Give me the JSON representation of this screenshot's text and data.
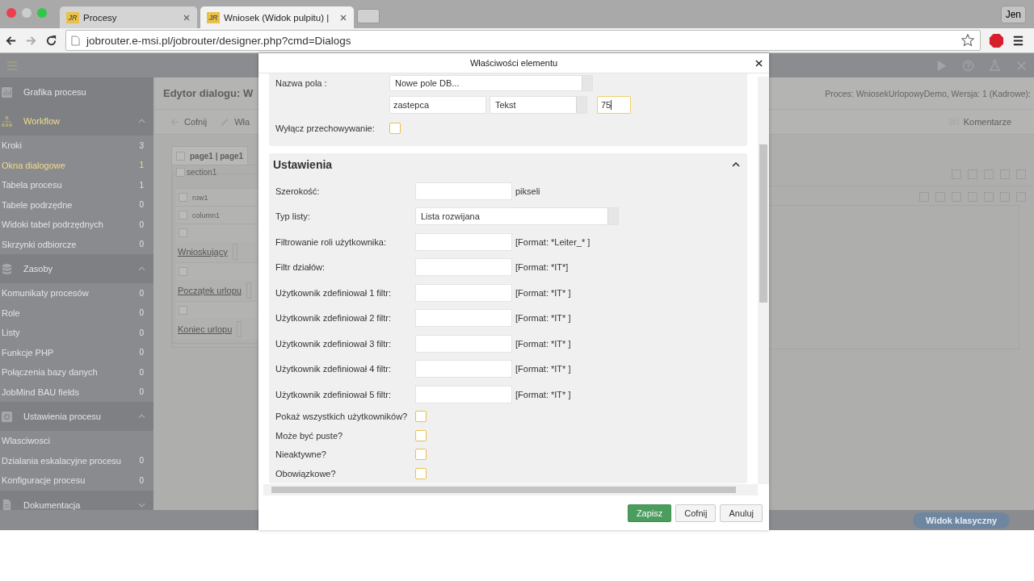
{
  "browser": {
    "tabs": [
      {
        "favicon_text": "JR",
        "title": "Procesy",
        "selected": false
      },
      {
        "favicon_text": "JR",
        "title": "Wniosek (Widok pulpitu) |",
        "selected": true
      }
    ],
    "url": "jobrouter.e-msi.pl/jobrouter/designer.php?cmd=Dialogs",
    "profile": "Jen"
  },
  "sidebar": [
    {
      "kind": "link",
      "label": "Grafika procesu"
    },
    {
      "kind": "group",
      "label": "Workflow",
      "expanded": true,
      "active": true,
      "items": [
        {
          "label": "Kroki",
          "count": "3",
          "selected": false
        },
        {
          "label": "Okna dialogowe",
          "count": "1",
          "selected": true
        },
        {
          "label": "Tabela procesu",
          "count": "1",
          "selected": false
        },
        {
          "label": "Tabele podrzędne",
          "count": "0",
          "selected": false
        },
        {
          "label": "Widoki tabel podrzędnych",
          "count": "0",
          "selected": false
        },
        {
          "label": "Skrzynki odbiorcze",
          "count": "0",
          "selected": false
        }
      ]
    },
    {
      "kind": "group",
      "label": "Zasoby",
      "expanded": true,
      "active": false,
      "items": [
        {
          "label": "Komunikaty procesów",
          "count": "0",
          "selected": false
        },
        {
          "label": "Role",
          "count": "0",
          "selected": false
        },
        {
          "label": "Listy",
          "count": "0",
          "selected": false
        },
        {
          "label": "Funkcje PHP",
          "count": "0",
          "selected": false
        },
        {
          "label": "Połączenia bazy danych",
          "count": "0",
          "selected": false
        },
        {
          "label": "JobMind BAU fields",
          "count": "0",
          "selected": false
        }
      ]
    },
    {
      "kind": "group",
      "label": "Ustawienia procesu",
      "expanded": true,
      "active": false,
      "items": [
        {
          "label": "Wlasciwosci",
          "selected": false
        },
        {
          "label": "Dzialania eskalacyjne procesu",
          "count": "0",
          "selected": false
        },
        {
          "label": "Konfiguracje procesu",
          "count": "0",
          "selected": false
        }
      ]
    },
    {
      "kind": "group",
      "label": "Dokumentacja",
      "expanded": false,
      "active": false
    }
  ],
  "editor": {
    "title": "Edytor dialogu: W",
    "process": "Proces: WniosekUrlopowyDemo, Wersja: 1 (Kadrowe):",
    "toolbar": [
      "Cofnij",
      "Wła"
    ],
    "comments": "Komentarze",
    "page_tab": "page1 | page1",
    "section": "section1",
    "rows": [
      "row1",
      "column1"
    ],
    "fields": [
      "Wnioskujący",
      "Początek urlopu",
      "Koniec urlopu"
    ],
    "footer_button": "Widok klasyczny"
  },
  "dialog": {
    "title": "Właściwości elementu",
    "field": {
      "label": "Nazwa pola :",
      "db_field": "Nowe pole DB...",
      "name": "zastepca",
      "type": "Tekst",
      "length": "75",
      "disable_storage_label": "Wyłącz przechowywanie:",
      "disable_storage": false
    },
    "settings": {
      "title": "Ustawienia",
      "expanded": true,
      "rows": [
        {
          "kind": "input",
          "label": "Szerokość:",
          "suffix": "pikseli"
        },
        {
          "kind": "select",
          "label": "Typ listy:",
          "value": "Lista rozwijana"
        },
        {
          "kind": "input",
          "label": "Filtrowanie roli użytkownika:",
          "suffix": "[Format: *Leiter_* ]"
        },
        {
          "kind": "input",
          "label": "Filtr działów:",
          "suffix": "[Format: *IT*]"
        },
        {
          "kind": "input",
          "label": "Użytkownik zdefiniował 1 filtr:",
          "suffix": "[Format: *IT* ]"
        },
        {
          "kind": "input",
          "label": "Użytkownik zdefiniował 2 filtr:",
          "suffix": "[Format: *IT* ]"
        },
        {
          "kind": "input",
          "label": "Użytkownik zdefiniował 3 filtr:",
          "suffix": "[Format: *IT* ]"
        },
        {
          "kind": "input",
          "label": "Użytkownik zdefiniował 4 filtr:",
          "suffix": "[Format: *IT* ]"
        },
        {
          "kind": "input",
          "label": "Użytkownik zdefiniował 5 filtr:",
          "suffix": "[Format: *IT* ]"
        },
        {
          "kind": "checkbox",
          "label": "Pokaż wszystkich użytkowników?",
          "checked": false
        },
        {
          "kind": "checkbox",
          "label": "Może być puste?",
          "checked": false
        },
        {
          "kind": "checkbox",
          "label": "Nieaktywne?",
          "checked": false
        },
        {
          "kind": "checkbox",
          "label": "Obowiązkowe?",
          "checked": false
        }
      ]
    },
    "buttons": [
      {
        "label": "Zapisz",
        "kind": "primary"
      },
      {
        "label": "Cofnij",
        "kind": "default"
      },
      {
        "label": "Anuluj",
        "kind": "default"
      }
    ]
  }
}
